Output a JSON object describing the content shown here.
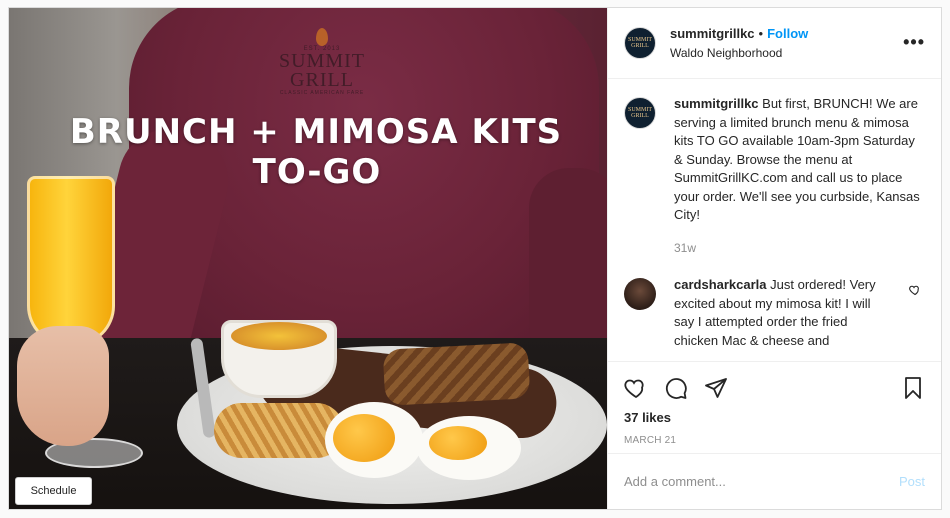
{
  "photo": {
    "headline_line1": "BRUNCH + MIMOSA KITS",
    "headline_line2": "TO-GO",
    "shirt_logo": {
      "est": "EST. 2013",
      "name_line1": "SUMMIT",
      "name_line2": "GRILL",
      "tagline": "CLASSIC AMERICAN FARE"
    },
    "schedule_label": "Schedule"
  },
  "header": {
    "username": "summitgrillkc",
    "separator": "•",
    "follow_label": "Follow",
    "location": "Waldo Neighborhood",
    "more_label": "•••",
    "avatar_text": "SUMMIT GRILL"
  },
  "caption": {
    "username": "summitgrillkc",
    "text": "But first, BRUNCH! We are serving a limited brunch menu & mimosa kits TO GO available 10am-3pm Saturday & Sunday. Browse the menu at SummitGrillKC.com and call us to place your order. We'll see you curbside, Kansas City!",
    "age": "31w"
  },
  "comments": [
    {
      "username": "cardsharkcarla",
      "text": "Just ordered! Very excited about my mimosa kit! I will say I attempted order the fried chicken Mac & cheese and"
    }
  ],
  "actions": {
    "icons": [
      "heart-icon",
      "comment-icon",
      "share-icon",
      "bookmark-icon"
    ],
    "likes": "37 likes",
    "date": "MARCH 21"
  },
  "add_comment": {
    "placeholder": "Add a comment...",
    "post_label": "Post"
  },
  "colors": {
    "follow_blue": "#0095f6",
    "post_disabled": "#b2dffc",
    "muted_text": "#8e8e8e"
  }
}
